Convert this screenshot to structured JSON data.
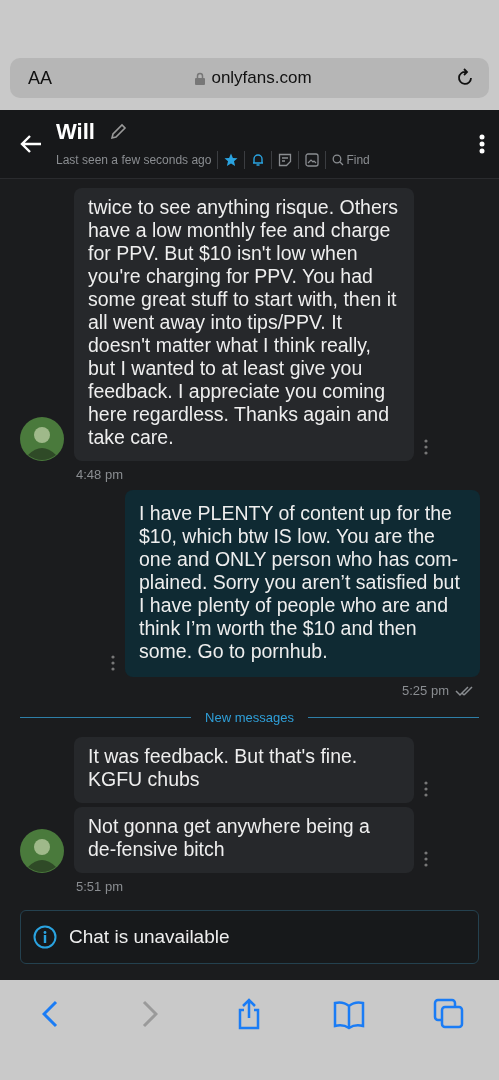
{
  "browser": {
    "text_size": "AA",
    "url": "onlyfans.com"
  },
  "header": {
    "name": "Will",
    "status": "Last seen a few seconds ago",
    "find": "Find"
  },
  "thread": [
    {
      "kind": "incoming",
      "messages": [
        "twice to see anything risque. Others have a low monthly fee and charge for PPV. But $10 isn't low when you're charging for PPV. You had some great stuff to start with, then it all went away into tips/PPV. It doesn't matter what I think really, but I wanted to at least give you feedback. I appreciate you coming here regardless. Thanks again and take care."
      ],
      "time": "4:48 pm"
    },
    {
      "kind": "outgoing",
      "messages": [
        "I have PLENTY of content up for the $10, which btw IS low. You are the one and ONLY person who has com-plained. Sorry you aren’t satisfied but I have plenty of people who are and think I’m worth the $10 and then some. Go to pornhub."
      ],
      "time": "5:25 pm",
      "read": true
    },
    {
      "kind": "divider",
      "label": "New messages"
    },
    {
      "kind": "incoming",
      "messages": [
        "It was feedback. But that's fine. KGFU chubs",
        "Not gonna get anywhere being a de-fensive bitch"
      ],
      "time": "5:51 pm"
    }
  ],
  "notice": "Chat is unavailable",
  "toolbar": [
    {
      "kind": "back",
      "disabled": false
    },
    {
      "kind": "forward",
      "disabled": true
    },
    {
      "kind": "share",
      "disabled": false
    },
    {
      "kind": "bookmarks",
      "disabled": false
    },
    {
      "kind": "tabs",
      "disabled": false
    }
  ]
}
